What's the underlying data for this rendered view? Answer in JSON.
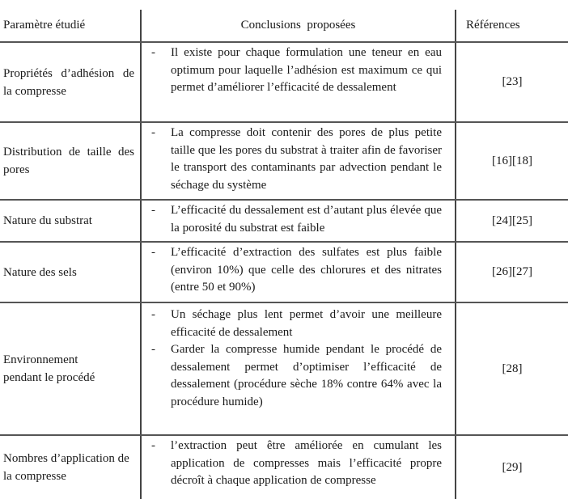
{
  "table": {
    "headers": {
      "parameter": "Paramètre étudié",
      "conclusions": "Conclusions  proposées",
      "references": "Références"
    },
    "rows": [
      {
        "parameter": "Propriétés d’adhésion de la compresse",
        "conclusions": [
          "Il existe pour chaque formulation une teneur en eau optimum pour laquelle l’adhésion est maximum ce qui permet d’améliorer l’efficacité de dessalement"
        ],
        "references": "[23]"
      },
      {
        "parameter": "Distribution de taille des pores",
        "conclusions": [
          "La compresse doit contenir des pores de plus petite taille que les pores du substrat à traiter afin de favoriser le transport des contaminants par advection pendant le séchage du système"
        ],
        "references": "[16][18]"
      },
      {
        "parameter": "Nature du substrat",
        "conclusions": [
          "L’efficacité du dessalement est d’autant plus élevée que la porosité du substrat est faible"
        ],
        "references": "[24][25]"
      },
      {
        "parameter": "Nature des sels",
        "conclusions": [
          "L’efficacité d’extraction des sulfates est plus faible (environ 10%) que celle des chlorures et des nitrates (entre 50 et 90%)"
        ],
        "references": "[26][27]"
      },
      {
        "parameter": "Environnement pendant le procédé",
        "conclusions": [
          "Un séchage plus lent permet d’avoir une meilleure efficacité de dessalement",
          "Garder la compresse humide pendant le procédé de dessalement permet d’optimiser l’efficacité de dessalement (procédure sèche 18% contre 64% avec la procédure humide)"
        ],
        "references": "[28]"
      },
      {
        "parameter": "Nombres d’application de la compresse",
        "conclusions": [
          "l’extraction peut être améliorée en cumulant les application de compresses mais l’efficacité propre décroît à chaque application de compresse"
        ],
        "references": "[29]"
      }
    ],
    "bullet_marker": "-"
  }
}
